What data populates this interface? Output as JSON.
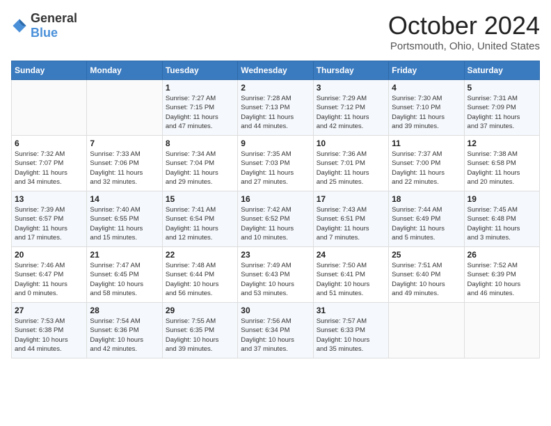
{
  "header": {
    "logo_general": "General",
    "logo_blue": "Blue",
    "month_title": "October 2024",
    "location": "Portsmouth, Ohio, United States"
  },
  "days_of_week": [
    "Sunday",
    "Monday",
    "Tuesday",
    "Wednesday",
    "Thursday",
    "Friday",
    "Saturday"
  ],
  "weeks": [
    [
      {
        "day": "",
        "info": ""
      },
      {
        "day": "",
        "info": ""
      },
      {
        "day": "1",
        "info": "Sunrise: 7:27 AM\nSunset: 7:15 PM\nDaylight: 11 hours\nand 47 minutes."
      },
      {
        "day": "2",
        "info": "Sunrise: 7:28 AM\nSunset: 7:13 PM\nDaylight: 11 hours\nand 44 minutes."
      },
      {
        "day": "3",
        "info": "Sunrise: 7:29 AM\nSunset: 7:12 PM\nDaylight: 11 hours\nand 42 minutes."
      },
      {
        "day": "4",
        "info": "Sunrise: 7:30 AM\nSunset: 7:10 PM\nDaylight: 11 hours\nand 39 minutes."
      },
      {
        "day": "5",
        "info": "Sunrise: 7:31 AM\nSunset: 7:09 PM\nDaylight: 11 hours\nand 37 minutes."
      }
    ],
    [
      {
        "day": "6",
        "info": "Sunrise: 7:32 AM\nSunset: 7:07 PM\nDaylight: 11 hours\nand 34 minutes."
      },
      {
        "day": "7",
        "info": "Sunrise: 7:33 AM\nSunset: 7:06 PM\nDaylight: 11 hours\nand 32 minutes."
      },
      {
        "day": "8",
        "info": "Sunrise: 7:34 AM\nSunset: 7:04 PM\nDaylight: 11 hours\nand 29 minutes."
      },
      {
        "day": "9",
        "info": "Sunrise: 7:35 AM\nSunset: 7:03 PM\nDaylight: 11 hours\nand 27 minutes."
      },
      {
        "day": "10",
        "info": "Sunrise: 7:36 AM\nSunset: 7:01 PM\nDaylight: 11 hours\nand 25 minutes."
      },
      {
        "day": "11",
        "info": "Sunrise: 7:37 AM\nSunset: 7:00 PM\nDaylight: 11 hours\nand 22 minutes."
      },
      {
        "day": "12",
        "info": "Sunrise: 7:38 AM\nSunset: 6:58 PM\nDaylight: 11 hours\nand 20 minutes."
      }
    ],
    [
      {
        "day": "13",
        "info": "Sunrise: 7:39 AM\nSunset: 6:57 PM\nDaylight: 11 hours\nand 17 minutes."
      },
      {
        "day": "14",
        "info": "Sunrise: 7:40 AM\nSunset: 6:55 PM\nDaylight: 11 hours\nand 15 minutes."
      },
      {
        "day": "15",
        "info": "Sunrise: 7:41 AM\nSunset: 6:54 PM\nDaylight: 11 hours\nand 12 minutes."
      },
      {
        "day": "16",
        "info": "Sunrise: 7:42 AM\nSunset: 6:52 PM\nDaylight: 11 hours\nand 10 minutes."
      },
      {
        "day": "17",
        "info": "Sunrise: 7:43 AM\nSunset: 6:51 PM\nDaylight: 11 hours\nand 7 minutes."
      },
      {
        "day": "18",
        "info": "Sunrise: 7:44 AM\nSunset: 6:49 PM\nDaylight: 11 hours\nand 5 minutes."
      },
      {
        "day": "19",
        "info": "Sunrise: 7:45 AM\nSunset: 6:48 PM\nDaylight: 11 hours\nand 3 minutes."
      }
    ],
    [
      {
        "day": "20",
        "info": "Sunrise: 7:46 AM\nSunset: 6:47 PM\nDaylight: 11 hours\nand 0 minutes."
      },
      {
        "day": "21",
        "info": "Sunrise: 7:47 AM\nSunset: 6:45 PM\nDaylight: 10 hours\nand 58 minutes."
      },
      {
        "day": "22",
        "info": "Sunrise: 7:48 AM\nSunset: 6:44 PM\nDaylight: 10 hours\nand 56 minutes."
      },
      {
        "day": "23",
        "info": "Sunrise: 7:49 AM\nSunset: 6:43 PM\nDaylight: 10 hours\nand 53 minutes."
      },
      {
        "day": "24",
        "info": "Sunrise: 7:50 AM\nSunset: 6:41 PM\nDaylight: 10 hours\nand 51 minutes."
      },
      {
        "day": "25",
        "info": "Sunrise: 7:51 AM\nSunset: 6:40 PM\nDaylight: 10 hours\nand 49 minutes."
      },
      {
        "day": "26",
        "info": "Sunrise: 7:52 AM\nSunset: 6:39 PM\nDaylight: 10 hours\nand 46 minutes."
      }
    ],
    [
      {
        "day": "27",
        "info": "Sunrise: 7:53 AM\nSunset: 6:38 PM\nDaylight: 10 hours\nand 44 minutes."
      },
      {
        "day": "28",
        "info": "Sunrise: 7:54 AM\nSunset: 6:36 PM\nDaylight: 10 hours\nand 42 minutes."
      },
      {
        "day": "29",
        "info": "Sunrise: 7:55 AM\nSunset: 6:35 PM\nDaylight: 10 hours\nand 39 minutes."
      },
      {
        "day": "30",
        "info": "Sunrise: 7:56 AM\nSunset: 6:34 PM\nDaylight: 10 hours\nand 37 minutes."
      },
      {
        "day": "31",
        "info": "Sunrise: 7:57 AM\nSunset: 6:33 PM\nDaylight: 10 hours\nand 35 minutes."
      },
      {
        "day": "",
        "info": ""
      },
      {
        "day": "",
        "info": ""
      }
    ]
  ]
}
